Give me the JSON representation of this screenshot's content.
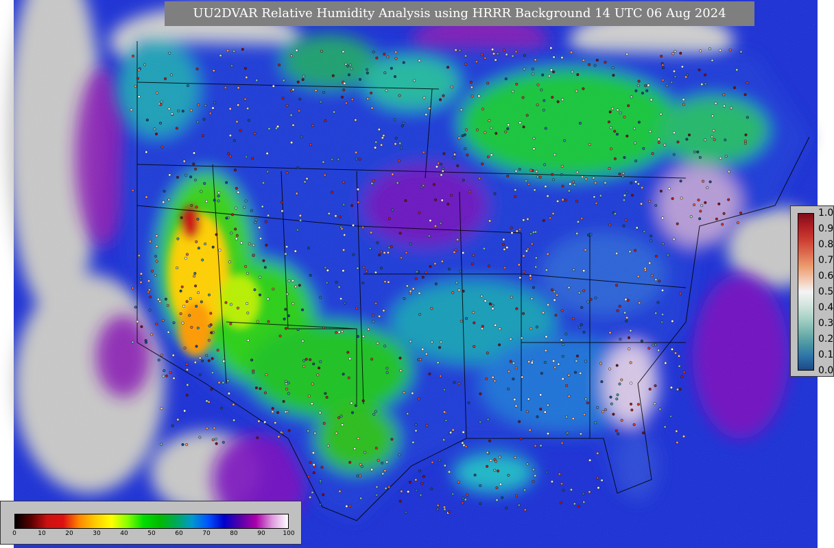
{
  "title": "UU2DVAR Relative Humidity Analysis using HRRR Background 14 UTC 06 Aug 2024",
  "right_colorbar": {
    "labels": [
      "1.0",
      "0.9",
      "0.8",
      "0.7",
      "0.6",
      "0.5",
      "0.4",
      "0.3",
      "0.2",
      "0.1",
      "0.0"
    ],
    "colors": [
      "#7f0e1c",
      "#b01f24",
      "#cc3d32",
      "#dc6a4e",
      "#eb9a6c",
      "#f4c5ad",
      "#f4f4f4",
      "#d4e5df",
      "#a9d3c7",
      "#7ab7b0",
      "#4b97a4",
      "#2d72a8",
      "#1b4a85"
    ]
  },
  "bottom_colorbar": {
    "ticks": [
      "0",
      "10",
      "20",
      "30",
      "40",
      "50",
      "60",
      "70",
      "80",
      "90",
      "100"
    ],
    "stops": [
      "#000000",
      "#5a0000",
      "#cc1111",
      "#dd1111",
      "#ff8800",
      "#ffcc00",
      "#ffff00",
      "#88ff00",
      "#00dd00",
      "#00bb00",
      "#00aa55",
      "#0099cc",
      "#0055ff",
      "#0000cc",
      "#5500aa",
      "#aa00aa",
      "#dd99dd",
      "#ffffff"
    ]
  }
}
